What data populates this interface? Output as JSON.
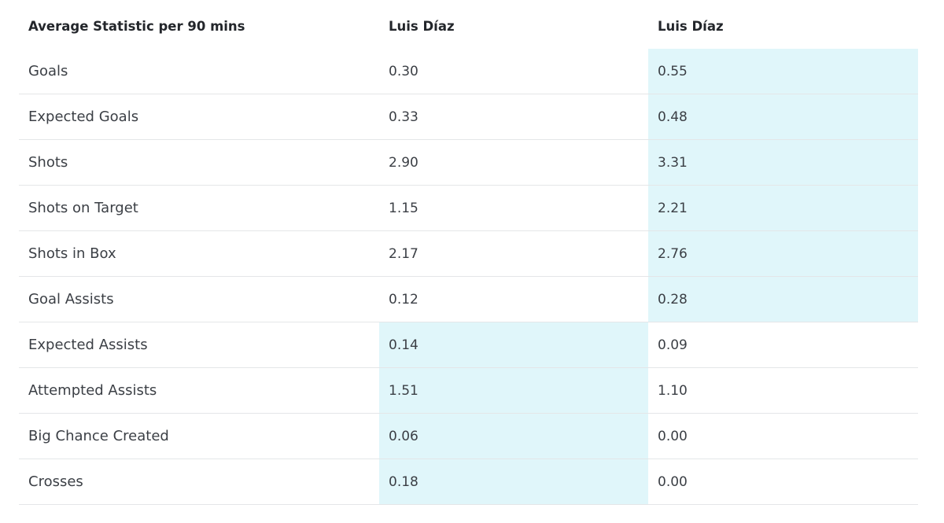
{
  "header": {
    "stat_label": "Average Statistic per 90 mins",
    "player1": "Luis Díaz",
    "player2": "Luis Díaz"
  },
  "colors": {
    "highlight": "#e0f6fa",
    "divider": "#e4e6e8",
    "text": "#3b3f45"
  },
  "rows": [
    {
      "stat": "Goals",
      "p1": "0.30",
      "p2": "0.55",
      "leader": "p2"
    },
    {
      "stat": "Expected Goals",
      "p1": "0.33",
      "p2": "0.48",
      "leader": "p2"
    },
    {
      "stat": "Shots",
      "p1": "2.90",
      "p2": "3.31",
      "leader": "p2"
    },
    {
      "stat": "Shots on Target",
      "p1": "1.15",
      "p2": "2.21",
      "leader": "p2"
    },
    {
      "stat": "Shots in Box",
      "p1": "2.17",
      "p2": "2.76",
      "leader": "p2"
    },
    {
      "stat": "Goal Assists",
      "p1": "0.12",
      "p2": "0.28",
      "leader": "p2"
    },
    {
      "stat": "Expected Assists",
      "p1": "0.14",
      "p2": "0.09",
      "leader": "p1"
    },
    {
      "stat": "Attempted Assists",
      "p1": "1.51",
      "p2": "1.10",
      "leader": "p1"
    },
    {
      "stat": "Big Chance Created",
      "p1": "0.06",
      "p2": "0.00",
      "leader": "p1"
    },
    {
      "stat": "Crosses",
      "p1": "0.18",
      "p2": "0.00",
      "leader": "p1"
    }
  ]
}
